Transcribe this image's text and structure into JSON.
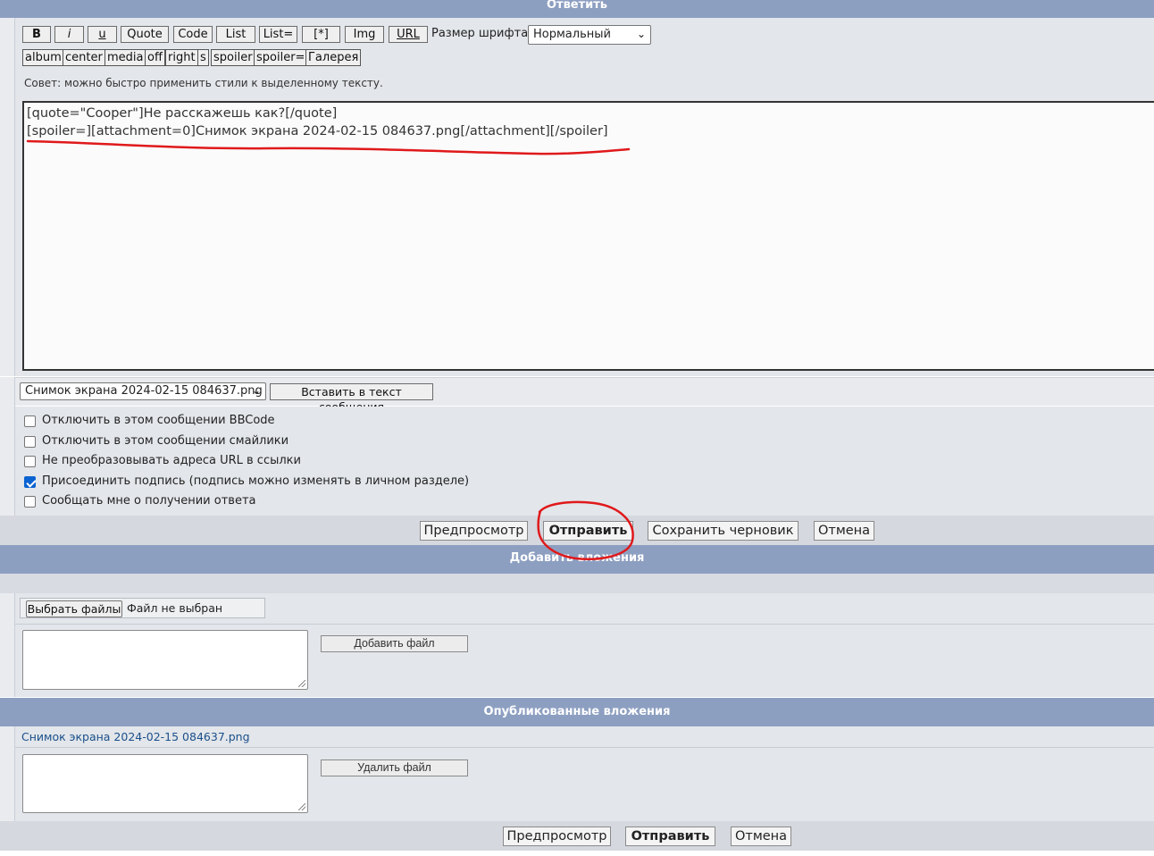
{
  "reply_header": {
    "title": "Ответить"
  },
  "toolbar": {
    "buttons_row1": [
      "B",
      "i",
      "u",
      "Quote",
      "Code",
      "List",
      "List=",
      "[*]",
      "Img",
      "URL"
    ],
    "font_size_label": "Размер шрифта:",
    "font_size_value": "Нормальный",
    "buttons_row2": [
      "album",
      "center",
      "media",
      "off",
      "right",
      "s",
      "spoiler",
      "spoiler=",
      "Галерея"
    ]
  },
  "tip": "Совет: можно быстро применить стили к выделенному тексту.",
  "message": {
    "line1": "[quote=\"Cooper\"]Не расскажешь как?[/quote]",
    "line2": "[spoiler=][attachment=0]Снимок экрана 2024-02-15 084637.png[/attachment][/spoiler]"
  },
  "attachment_insert": {
    "selected": "Снимок экрана 2024-02-15 084637.png",
    "button": "Вставить в текст сообщения"
  },
  "options": [
    {
      "label": "Отключить в этом сообщении BBCode",
      "checked": false
    },
    {
      "label": "Отключить в этом сообщении смайлики",
      "checked": false
    },
    {
      "label": "Не преобразовывать адреса URL в ссылки",
      "checked": false
    },
    {
      "label": "Присоединить подпись (подпись можно изменять в личном разделе)",
      "checked": true
    },
    {
      "label": "Сообщать мне о получении ответа",
      "checked": false
    }
  ],
  "actions_top": {
    "preview": "Предпросмотр",
    "submit": "Отправить",
    "save_draft": "Сохранить черновик",
    "cancel": "Отмена"
  },
  "add_attachments": {
    "title": "Добавить вложения",
    "choose_files": "Выбрать файлы",
    "no_file": "Файл не выбран",
    "add_file": "Добавить файл"
  },
  "published_attachments": {
    "title": "Опубликованные вложения",
    "file_name": "Снимок экрана 2024-02-15 084637.png",
    "delete_file": "Удалить файл"
  },
  "actions_bottom": {
    "preview": "Предпросмотр",
    "submit": "Отправить",
    "cancel": "Отмена"
  },
  "colors": {
    "header_bar": "#8d9fc1",
    "panel": "#e3e6ea",
    "annotation_red": "#e0191b",
    "link": "#1a4f8b"
  }
}
